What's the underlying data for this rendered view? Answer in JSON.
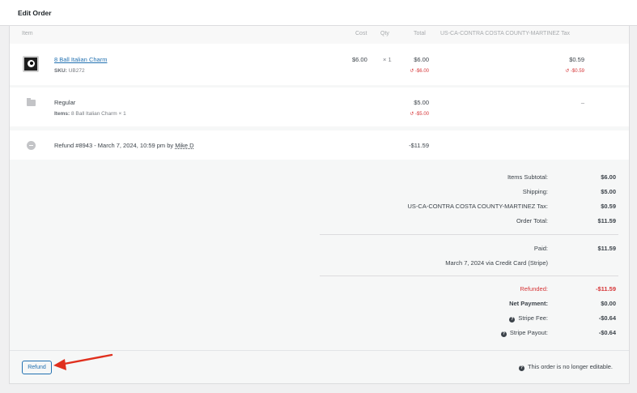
{
  "header": {
    "title": "Edit Order"
  },
  "table": {
    "columns": {
      "item": "Item",
      "cost": "Cost",
      "qty": "Qty",
      "total": "Total",
      "tax": "US-CA-CONTRA COSTA COUNTY-MARTINEZ Tax"
    },
    "line_item": {
      "name": "8 Ball Italian Charm",
      "sku_label": "SKU:",
      "sku": "UB272",
      "cost": "$6.00",
      "qty": "× 1",
      "total": "$6.00",
      "refunded_total": "↺ -$6.00",
      "tax": "$0.59",
      "refunded_tax": "↺ -$0.59"
    },
    "shipping": {
      "name": "Regular",
      "items_label": "Items:",
      "items": "8 Ball Italian Charm × 1",
      "total": "$5.00",
      "refunded_total": "↺ -$5.00",
      "tax": "–"
    },
    "refund": {
      "text_prefix": "Refund #8943 - March 7, 2024, 10:59 pm by ",
      "user": "Mike D",
      "amount": "-$11.59"
    }
  },
  "totals": {
    "items_subtotal_label": "Items Subtotal:",
    "items_subtotal": "$6.00",
    "shipping_label": "Shipping:",
    "shipping": "$5.00",
    "tax_label": "US-CA-CONTRA COSTA COUNTY-MARTINEZ Tax:",
    "tax": "$0.59",
    "order_total_label": "Order Total:",
    "order_total": "$11.59",
    "paid_label": "Paid:",
    "paid": "$11.59",
    "paid_note": "March 7, 2024 via Credit Card (Stripe)",
    "refunded_label": "Refunded:",
    "refunded": "-$11.59",
    "net_payment_label": "Net Payment:",
    "net_payment": "$0.00",
    "stripe_fee_label": "Stripe Fee:",
    "stripe_fee": "-$0.64",
    "stripe_payout_label": "Stripe Payout:",
    "stripe_payout": "-$0.64"
  },
  "footer": {
    "refund_button": "Refund",
    "note": "This order is no longer editable."
  },
  "colors": {
    "link": "#2271b1",
    "danger": "#d63638",
    "annotation_arrow": "#e0301e"
  }
}
